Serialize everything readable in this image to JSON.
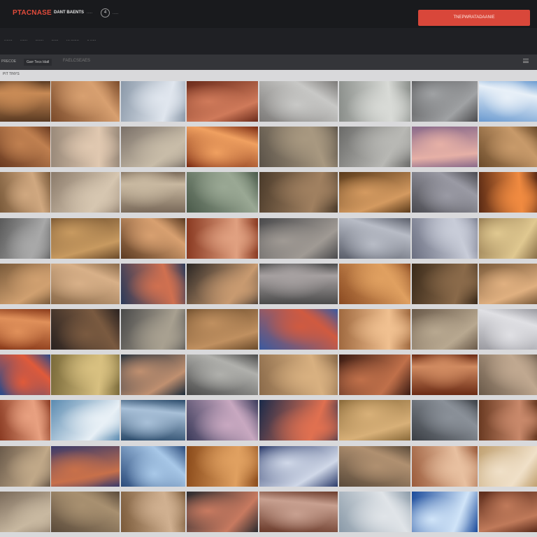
{
  "header": {
    "logo": "PTACNASE",
    "nav_primary": "DANT BAENTS",
    "nav_secondary": "·····",
    "badge": "4",
    "nav_tertiary": "·····",
    "cta_label": "TNEPWRATADAANIE"
  },
  "subnav": {
    "links": [
      "·······",
      "······",
      "·······",
      "······",
      "··· ·······",
      "·· ·····"
    ]
  },
  "filter_bar": {
    "left": "PRECOE",
    "chip": "Garr Tecs Idatl",
    "right": "FAELCSEAES"
  },
  "section": {
    "label": "PIT TINYS"
  },
  "palette": {
    "accent": "#d9473a",
    "background": "#2a2c30",
    "content_bg": "#d9d9db"
  },
  "thumbnails": [
    [
      {
        "c": [
          "#5a3a22",
          "#c88a55"
        ]
      },
      {
        "c": [
          "#7a4a2a",
          "#d8a070"
        ]
      },
      {
        "c": [
          "#8a98a8",
          "#e0e6ee"
        ]
      },
      {
        "c": [
          "#6a2a1a",
          "#d07a5a"
        ]
      },
      {
        "c": [
          "#7c7a78",
          "#c8c8c6"
        ]
      },
      {
        "c": [
          "#8a8e8a",
          "#d8dad6"
        ]
      },
      {
        "c": [
          "#4a4a4c",
          "#a0a2a4"
        ]
      },
      {
        "c": [
          "#6a9ad0",
          "#e8f0f8"
        ]
      }
    ],
    [
      {
        "c": [
          "#6a3a20",
          "#c08050"
        ]
      },
      {
        "c": [
          "#9a8a7a",
          "#e0c8b0"
        ]
      },
      {
        "c": [
          "#7a7068",
          "#c8bca8"
        ]
      },
      {
        "c": [
          "#7a2a12",
          "#f0a060"
        ]
      },
      {
        "c": [
          "#5a5248",
          "#a89880"
        ]
      },
      {
        "c": [
          "#6a6a68",
          "#b8b8b4"
        ]
      },
      {
        "c": [
          "#8a6a8a",
          "#e6b0a6"
        ]
      },
      {
        "c": [
          "#6a4a2a",
          "#c89a6a"
        ]
      }
    ],
    [
      {
        "c": [
          "#7a5a3a",
          "#d0a880"
        ]
      },
      {
        "c": [
          "#8a7a6a",
          "#d6c6b0"
        ]
      },
      {
        "c": [
          "#7a6a5a",
          "#c8b8a0"
        ]
      },
      {
        "c": [
          "#4a5a4a",
          "#9aa894"
        ]
      },
      {
        "c": [
          "#4a3a2a",
          "#a08060"
        ]
      },
      {
        "c": [
          "#5a3a1a",
          "#d49a60"
        ]
      },
      {
        "c": [
          "#4a4a50",
          "#9a9aa4"
        ]
      },
      {
        "c": [
          "#5a2a14",
          "#f08a40"
        ]
      }
    ],
    [
      {
        "c": [
          "#5a5a5a",
          "#a8a8a8"
        ]
      },
      {
        "c": [
          "#6a4a2a",
          "#c89a60"
        ]
      },
      {
        "c": [
          "#5a3a22",
          "#d8a070"
        ]
      },
      {
        "c": [
          "#8a3a22",
          "#e0a080"
        ]
      },
      {
        "c": [
          "#4a4a4c",
          "#a09a94"
        ]
      },
      {
        "c": [
          "#5a5e6a",
          "#b8bcc6"
        ]
      },
      {
        "c": [
          "#6a6e80",
          "#c8ccd8"
        ]
      },
      {
        "c": [
          "#8a7048",
          "#e0c890"
        ]
      }
    ],
    [
      {
        "c": [
          "#7a5a3a",
          "#d0a070"
        ]
      },
      {
        "c": [
          "#8a6a4a",
          "#d8b088"
        ]
      },
      {
        "c": [
          "#2a3a5a",
          "#d07050"
        ]
      },
      {
        "c": [
          "#2a2624",
          "#c89a70"
        ]
      },
      {
        "c": [
          "#4a4a4a",
          "#a6a0a0"
        ]
      },
      {
        "c": [
          "#8a4a22",
          "#e0a060"
        ]
      },
      {
        "c": [
          "#3a2a1a",
          "#8a6a4a"
        ]
      },
      {
        "c": [
          "#7a5a3a",
          "#e0b080"
        ]
      }
    ],
    [
      {
        "c": [
          "#8a3a1a",
          "#e0905a"
        ]
      },
      {
        "c": [
          "#2a2220",
          "#7a5a40"
        ]
      },
      {
        "c": [
          "#4a4a4a",
          "#a8a090"
        ]
      },
      {
        "c": [
          "#6a4a2a",
          "#c09060"
        ]
      },
      {
        "c": [
          "#3a5aa0",
          "#d05a40"
        ]
      },
      {
        "c": [
          "#a06a40",
          "#f0c090"
        ]
      },
      {
        "c": [
          "#6a5a4a",
          "#b8a890"
        ]
      },
      {
        "c": [
          "#9a9aa0",
          "#e0e0e4"
        ]
      }
    ],
    [
      {
        "c": [
          "#2a4a8a",
          "#e05a3a"
        ]
      },
      {
        "c": [
          "#7a6a3a",
          "#d8c080"
        ]
      },
      {
        "c": [
          "#1a2a3a",
          "#c09070"
        ]
      },
      {
        "c": [
          "#4a4a4a",
          "#b0b0ac"
        ]
      },
      {
        "c": [
          "#8a6a4a",
          "#d8b080"
        ]
      },
      {
        "c": [
          "#3a1a12",
          "#c0704a"
        ]
      },
      {
        "c": [
          "#6a2a14",
          "#d08a60"
        ]
      },
      {
        "c": [
          "#6a5a4a",
          "#c0a890"
        ]
      }
    ],
    [
      {
        "c": [
          "#8a3a22",
          "#e8a080"
        ]
      },
      {
        "c": [
          "#5a8ab0",
          "#e8f0f6"
        ]
      },
      {
        "c": [
          "#2a4a6a",
          "#a8c0d8"
        ]
      },
      {
        "c": [
          "#3a3a5a",
          "#c8a8c0"
        ]
      },
      {
        "c": [
          "#1a2a4a",
          "#e07050"
        ]
      },
      {
        "c": [
          "#8a6a3a",
          "#d8b078"
        ]
      },
      {
        "c": [
          "#3a3e44",
          "#8a9098"
        ]
      },
      {
        "c": [
          "#6a3a22",
          "#c8886a"
        ]
      }
    ],
    [
      {
        "c": [
          "#6a5a4a",
          "#c0a888"
        ]
      },
      {
        "c": [
          "#3a3a6a",
          "#c8704a"
        ]
      },
      {
        "c": [
          "#2a4a7a",
          "#a8c8e8"
        ]
      },
      {
        "c": [
          "#8a4a1a",
          "#e0a060"
        ]
      },
      {
        "c": [
          "#2a3a6a",
          "#d0d8e8"
        ]
      },
      {
        "c": [
          "#5a4a3a",
          "#b09070"
        ]
      },
      {
        "c": [
          "#9a5a3a",
          "#e8c0a0"
        ]
      },
      {
        "c": [
          "#c0a070",
          "#f0e0c8"
        ]
      }
    ],
    [
      {
        "c": [
          "#7a6a5a",
          "#c8b8a0"
        ]
      },
      {
        "c": [
          "#5a4a3a",
          "#a89070"
        ]
      },
      {
        "c": [
          "#7a5a3a",
          "#d0b090"
        ]
      },
      {
        "c": [
          "#2a2a2e",
          "#c87a60"
        ]
      },
      {
        "c": [
          "#6a3a2a",
          "#c8a090"
        ]
      },
      {
        "c": [
          "#8a9aa8",
          "#e0e4e8"
        ]
      },
      {
        "c": [
          "#1a4a9a",
          "#d0e4f8"
        ]
      },
      {
        "c": [
          "#5a2a1a",
          "#c07a5a"
        ]
      }
    ]
  ]
}
